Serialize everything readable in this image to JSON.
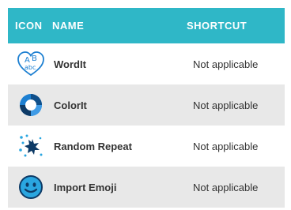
{
  "header": {
    "icon": "ICON",
    "name": "NAME",
    "shortcut": "SHORTCUT"
  },
  "rows": [
    {
      "icon": "wordit-icon",
      "name": "WordIt",
      "shortcut": "Not applicable"
    },
    {
      "icon": "colorit-icon",
      "name": "ColorIt",
      "shortcut": "Not applicable"
    },
    {
      "icon": "random-repeat-icon",
      "name": "Random Repeat",
      "shortcut": "Not applicable"
    },
    {
      "icon": "import-emoji-icon",
      "name": "Import Emoji",
      "shortcut": "Not applicable"
    }
  ],
  "colors": {
    "header_bg": "#2fb7c7",
    "alt_row_bg": "#e8e8e8",
    "accent": "#1c7fd1"
  }
}
